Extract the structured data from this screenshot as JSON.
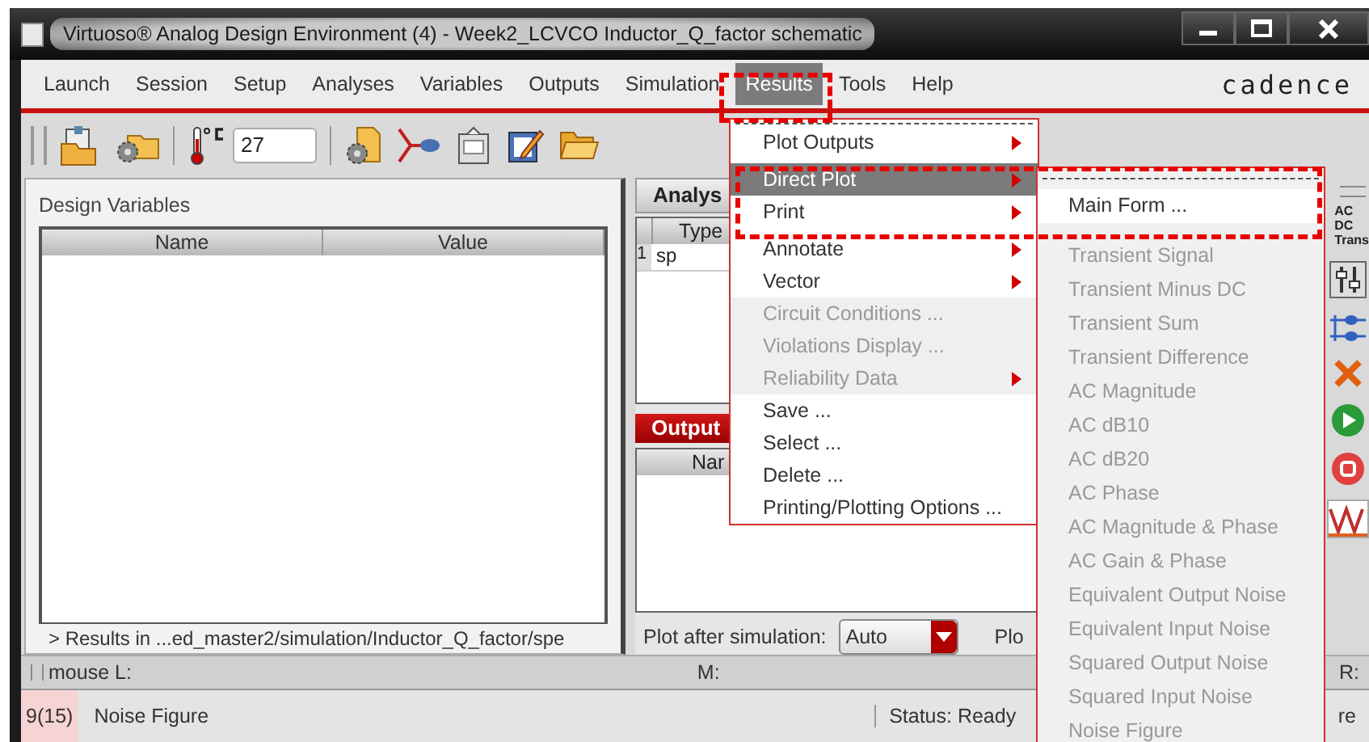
{
  "window": {
    "title": "Virtuoso® Analog Design Environment (4) - Week2_LCVCO Inductor_Q_factor schematic"
  },
  "menubar": [
    {
      "label": "Launch",
      "open": false
    },
    {
      "label": "Session",
      "open": false
    },
    {
      "label": "Setup",
      "open": false
    },
    {
      "label": "Analyses",
      "open": false
    },
    {
      "label": "Variables",
      "open": false
    },
    {
      "label": "Outputs",
      "open": false
    },
    {
      "label": "Simulation",
      "open": false
    },
    {
      "label": "Results",
      "open": true
    },
    {
      "label": "Tools",
      "open": false
    },
    {
      "label": "Help",
      "open": false
    }
  ],
  "logo": "cadence",
  "toolbar": {
    "temperature": "27"
  },
  "design_variables": {
    "title": "Design Variables",
    "columns": [
      "Name",
      "Value"
    ],
    "results_path": "> Results in ...ed_master2/simulation/Inductor_Q_factor/spe"
  },
  "analyses": {
    "title": "Analys",
    "columns": [
      "Type"
    ],
    "rows": [
      {
        "index": "1",
        "type": "sp"
      }
    ]
  },
  "outputs": {
    "title": "Output",
    "columns": [
      "Nar"
    ]
  },
  "plot_after": {
    "label": "Plot after simulation:",
    "value": "Auto",
    "next_label": "Plo"
  },
  "mode_options": [
    "AC",
    "DC",
    "Trans"
  ],
  "mouse_bar": {
    "left": "mouse L:",
    "middle": "M:",
    "right": "R:"
  },
  "status_bar": {
    "count": "9(15)",
    "message": "Noise Figure",
    "status": "Status: Ready",
    "tail": "re"
  },
  "results_menu": [
    {
      "label": "Plot Outputs",
      "submenu": true,
      "disabled": false,
      "selected": false
    },
    {
      "label": "Direct Plot",
      "submenu": true,
      "disabled": false,
      "selected": true
    },
    {
      "label": "Print",
      "submenu": true,
      "disabled": false,
      "selected": false
    },
    {
      "label": "Annotate",
      "submenu": true,
      "disabled": false,
      "selected": false
    },
    {
      "label": "Vector",
      "submenu": true,
      "disabled": false,
      "selected": false
    },
    {
      "label": "Circuit Conditions ...",
      "submenu": false,
      "disabled": true,
      "selected": false
    },
    {
      "label": "Violations Display ...",
      "submenu": false,
      "disabled": true,
      "selected": false
    },
    {
      "label": "Reliability Data",
      "submenu": true,
      "disabled": true,
      "selected": false
    },
    {
      "label": "Save ...",
      "submenu": false,
      "disabled": false,
      "selected": false
    },
    {
      "label": "Select ...",
      "submenu": false,
      "disabled": false,
      "selected": false
    },
    {
      "label": "Delete ...",
      "submenu": false,
      "disabled": false,
      "selected": false
    },
    {
      "label": "Printing/Plotting Options ...",
      "submenu": false,
      "disabled": false,
      "selected": false
    }
  ],
  "direct_plot_menu": [
    {
      "label": "Main Form ...",
      "disabled": false
    },
    {
      "label": "Transient Signal",
      "disabled": true
    },
    {
      "label": "Transient Minus DC",
      "disabled": true
    },
    {
      "label": "Transient Sum",
      "disabled": true
    },
    {
      "label": "Transient Difference",
      "disabled": true
    },
    {
      "label": "AC Magnitude",
      "disabled": true
    },
    {
      "label": "AC dB10",
      "disabled": true
    },
    {
      "label": "AC dB20",
      "disabled": true
    },
    {
      "label": "AC Phase",
      "disabled": true
    },
    {
      "label": "AC Magnitude & Phase",
      "disabled": true
    },
    {
      "label": "AC Gain & Phase",
      "disabled": true
    },
    {
      "label": "Equivalent Output Noise",
      "disabled": true
    },
    {
      "label": "Equivalent Input Noise",
      "disabled": true
    },
    {
      "label": "Squared Output Noise",
      "disabled": true
    },
    {
      "label": "Squared Input Noise",
      "disabled": true
    },
    {
      "label": "Noise Figure",
      "disabled": true
    }
  ],
  "callouts": [
    {
      "kind": "dashed-frame"
    },
    {
      "kind": "dashed-frame"
    }
  ]
}
